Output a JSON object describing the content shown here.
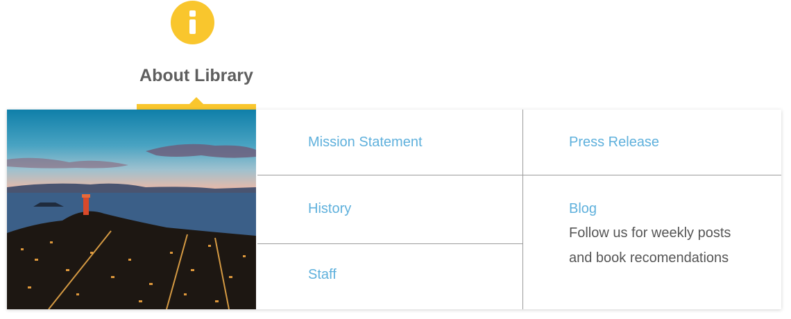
{
  "section": {
    "title": "About Library",
    "icon": "info-icon",
    "accent_color": "#f9c62d"
  },
  "menu": {
    "link_color": "#5eb0dc",
    "items": [
      {
        "label": "Mission Statement"
      },
      {
        "label": "Press Release"
      },
      {
        "label": "History"
      },
      {
        "label": "Blog",
        "description_lines": [
          "Follow us for weekly posts",
          "and book recomendations"
        ]
      },
      {
        "label": "Staff"
      }
    ]
  }
}
